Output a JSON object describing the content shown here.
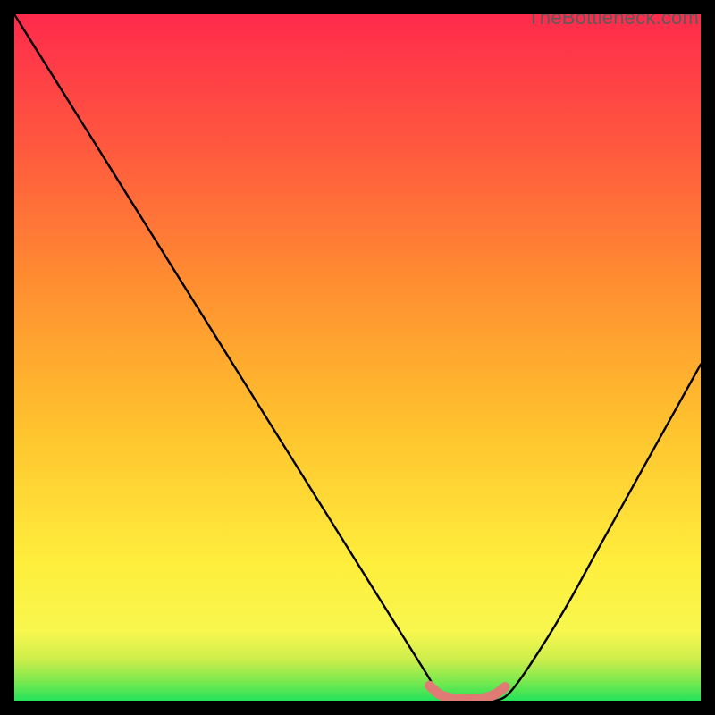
{
  "watermark": "TheBottleneck.com",
  "chart_data": {
    "type": "line",
    "title": "",
    "xlabel": "",
    "ylabel": "",
    "xlim": [
      0,
      100
    ],
    "ylim": [
      0,
      100
    ],
    "grid": false,
    "annotations": [
      {
        "text": "TheBottleneck.com",
        "position": "top-right"
      }
    ],
    "background_gradient_vertical": [
      {
        "y": 0,
        "color": "#24e35b"
      },
      {
        "y": 3,
        "color": "#7fe94e"
      },
      {
        "y": 6,
        "color": "#cdee4c"
      },
      {
        "y": 10,
        "color": "#f7f74e"
      },
      {
        "y": 20,
        "color": "#ffee3c"
      },
      {
        "y": 40,
        "color": "#ffc22e"
      },
      {
        "y": 60,
        "color": "#ff9030"
      },
      {
        "y": 80,
        "color": "#ff5a3e"
      },
      {
        "y": 100,
        "color": "#ff2a4c"
      }
    ],
    "series": [
      {
        "name": "bottleneck-curve",
        "color": "#000000",
        "x": [
          0,
          5,
          10,
          15,
          20,
          25,
          30,
          35,
          40,
          45,
          50,
          55,
          60,
          62,
          65,
          68,
          70,
          72,
          75,
          80,
          85,
          90,
          95,
          100
        ],
        "y": [
          100,
          92,
          84,
          76,
          68,
          60,
          52,
          44,
          36,
          28,
          20,
          12,
          4,
          1,
          0,
          0,
          0,
          1,
          5,
          13,
          22,
          31,
          40,
          49
        ]
      }
    ],
    "highlight": {
      "name": "flat-valley",
      "color": "#e07a74",
      "thickness": 11,
      "x": [
        60.5,
        62,
        64,
        66,
        68,
        70,
        71.5
      ],
      "y": [
        2.2,
        0.9,
        0.3,
        0.2,
        0.3,
        0.9,
        2.0
      ]
    }
  }
}
